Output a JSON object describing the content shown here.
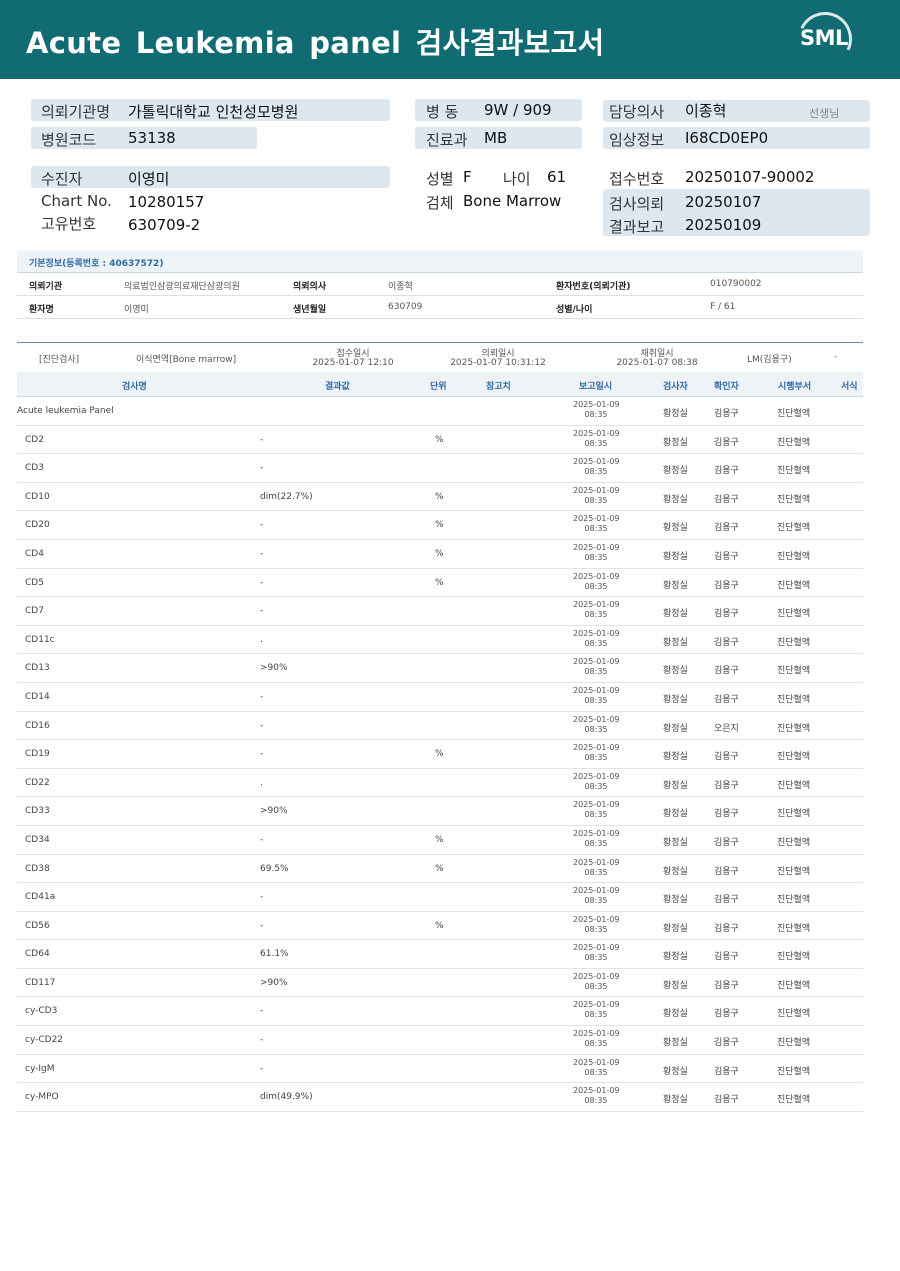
{
  "report": {
    "title": "Acute  Leukemia  panel 검사결과보고서",
    "logo_text": "SML"
  },
  "patient_header": {
    "institution_label": "의뢰기관명",
    "institution": "가톨릭대학교 인천성모병원",
    "hospital_code_label": "병원코드",
    "hospital_code": "53138",
    "ward_label": "병  동",
    "ward": "9W / 909",
    "dept_label": "진료과",
    "dept": "MB",
    "doctor_label": "담당의사",
    "doctor": "이종혁",
    "doctor_suffix": "선생님",
    "clinical_label": "임상정보",
    "clinical": "I68CD0EP0",
    "patient_label": "수진자",
    "patient": "이영미",
    "chart_label": "Chart No.",
    "chart": "10280157",
    "unique_label": "고유번호",
    "unique": "630709-2",
    "sex_label": "성별",
    "sex": "F",
    "age_label": "나이",
    "age": "61",
    "specimen_label": "검체",
    "specimen": "Bone Marrow",
    "receipt_label": "접수번호",
    "receipt": "20250107-90002",
    "request_label": "검사의뢰",
    "request": "20250107",
    "result_label": "결과보고",
    "result": "20250109"
  },
  "basic_info": {
    "heading": "기본정보(등록번호 : 40637572)",
    "institution_label": "의뢰기관",
    "institution": "의료법인삼광의료재단삼광의원",
    "doctor_label": "의뢰의사",
    "doctor": "이종혁",
    "patient_no_label": "환자번호(의뢰기관)",
    "patient_no": "010790002",
    "patient_label": "환자명",
    "patient": "이영미",
    "birth_label": "생년월일",
    "birth": "630709",
    "sexage_label": "성별/나이",
    "sexage": "F / 61"
  },
  "exam_info": {
    "category": "[진단검사]",
    "specimen": "이식면역[Bone marrow]",
    "receipt_label": "접수일시",
    "receipt": "2025-01-07 12:10",
    "request_label": "의뢰일시",
    "request": "2025-01-07 10:31:12",
    "collect_label": "채취일시",
    "collect": "2025-01-07 08:38",
    "reporter": "LM(김용구)",
    "dash": "-"
  },
  "table_header": {
    "name": "검사명",
    "result": "결과값",
    "unit": "단위",
    "ref": "참고치",
    "report": "보고일시",
    "tech": "검사자",
    "confirm": "확인자",
    "dept": "시행부서",
    "format": "서식"
  },
  "rows": [
    {
      "name": "Acute leukemia Panel",
      "result": "",
      "unit": "",
      "d": "2025-01-09",
      "t": "08:35",
      "tech": "황정실",
      "conf": "김용구",
      "dept": "진단혈액"
    },
    {
      "name": "CD2",
      "result": "-",
      "unit": "%",
      "d": "2025-01-09",
      "t": "08:35",
      "tech": "황정실",
      "conf": "김용구",
      "dept": "진단혈액"
    },
    {
      "name": "CD3",
      "result": "-",
      "unit": "",
      "d": "2025-01-09",
      "t": "08:35",
      "tech": "황정실",
      "conf": "김용구",
      "dept": "진단혈액"
    },
    {
      "name": "CD10",
      "result": "dim(22.7%)",
      "unit": "%",
      "d": "2025-01-09",
      "t": "08:35",
      "tech": "황정실",
      "conf": "김용구",
      "dept": "진단혈액"
    },
    {
      "name": "CD20",
      "result": "-",
      "unit": "%",
      "d": "2025-01-09",
      "t": "08:35",
      "tech": "황정실",
      "conf": "김용구",
      "dept": "진단혈액"
    },
    {
      "name": "CD4",
      "result": "-",
      "unit": "%",
      "d": "2025-01-09",
      "t": "08:35",
      "tech": "황정실",
      "conf": "김용구",
      "dept": "진단혈액"
    },
    {
      "name": "CD5",
      "result": "-",
      "unit": "%",
      "d": "2025-01-09",
      "t": "08:35",
      "tech": "황정실",
      "conf": "김용구",
      "dept": "진단혈액"
    },
    {
      "name": "CD7",
      "result": "-",
      "unit": "",
      "d": "2025-01-09",
      "t": "08:35",
      "tech": "황정실",
      "conf": "김용구",
      "dept": "진단혈액"
    },
    {
      "name": "CD11c",
      "result": ".",
      "unit": "",
      "d": "2025-01-09",
      "t": "08:35",
      "tech": "황정실",
      "conf": "김용구",
      "dept": "진단혈액"
    },
    {
      "name": "CD13",
      "result": ">90%",
      "unit": "",
      "d": "2025-01-09",
      "t": "08:35",
      "tech": "황정실",
      "conf": "김용구",
      "dept": "진단혈액"
    },
    {
      "name": "CD14",
      "result": "-",
      "unit": "",
      "d": "2025-01-09",
      "t": "08:35",
      "tech": "황정실",
      "conf": "김용구",
      "dept": "진단혈액"
    },
    {
      "name": "CD16",
      "result": "-",
      "unit": "",
      "d": "2025-01-09",
      "t": "08:35",
      "tech": "황정실",
      "conf": "오은지",
      "dept": "진단혈액"
    },
    {
      "name": "CD19",
      "result": "-",
      "unit": "%",
      "d": "2025-01-09",
      "t": "08:35",
      "tech": "황정실",
      "conf": "김용구",
      "dept": "진단혈액"
    },
    {
      "name": "CD22",
      "result": ".",
      "unit": "",
      "d": "2025-01-09",
      "t": "08:35",
      "tech": "황정실",
      "conf": "김용구",
      "dept": "진단혈액"
    },
    {
      "name": "CD33",
      "result": ">90%",
      "unit": "",
      "d": "2025-01-09",
      "t": "08:35",
      "tech": "황정실",
      "conf": "김용구",
      "dept": "진단혈액"
    },
    {
      "name": "CD34",
      "result": "-",
      "unit": "%",
      "d": "2025-01-09",
      "t": "08:35",
      "tech": "황정실",
      "conf": "김용구",
      "dept": "진단혈액"
    },
    {
      "name": "CD38",
      "result": "69.5%",
      "unit": "%",
      "d": "2025-01-09",
      "t": "08:35",
      "tech": "황정실",
      "conf": "김용구",
      "dept": "진단혈액"
    },
    {
      "name": "CD41a",
      "result": "-",
      "unit": "",
      "d": "2025-01-09",
      "t": "08:35",
      "tech": "황정실",
      "conf": "김용구",
      "dept": "진단혈액"
    },
    {
      "name": "CD56",
      "result": "-",
      "unit": "%",
      "d": "2025-01-09",
      "t": "08:35",
      "tech": "황정실",
      "conf": "김용구",
      "dept": "진단혈액"
    },
    {
      "name": "CD64",
      "result": "61.1%",
      "unit": "",
      "d": "2025-01-09",
      "t": "08:35",
      "tech": "황정실",
      "conf": "김용구",
      "dept": "진단혈액"
    },
    {
      "name": "CD117",
      "result": ">90%",
      "unit": "",
      "d": "2025-01-09",
      "t": "08:35",
      "tech": "황정실",
      "conf": "김용구",
      "dept": "진단혈액"
    },
    {
      "name": "cy-CD3",
      "result": "-",
      "unit": "",
      "d": "2025-01-09",
      "t": "08:35",
      "tech": "황정실",
      "conf": "김용구",
      "dept": "진단혈액"
    },
    {
      "name": "cy-CD22",
      "result": "-",
      "unit": "",
      "d": "2025-01-09",
      "t": "08:35",
      "tech": "황정실",
      "conf": "김용구",
      "dept": "진단혈액"
    },
    {
      "name": "cy-IgM",
      "result": "-",
      "unit": "",
      "d": "2025-01-09",
      "t": "08:35",
      "tech": "황정실",
      "conf": "김용구",
      "dept": "진단혈액"
    },
    {
      "name": "cy-MPO",
      "result": "dim(49.9%)",
      "unit": "",
      "d": "2025-01-09",
      "t": "08:35",
      "tech": "황정실",
      "conf": "김용구",
      "dept": "진단혈액"
    }
  ]
}
